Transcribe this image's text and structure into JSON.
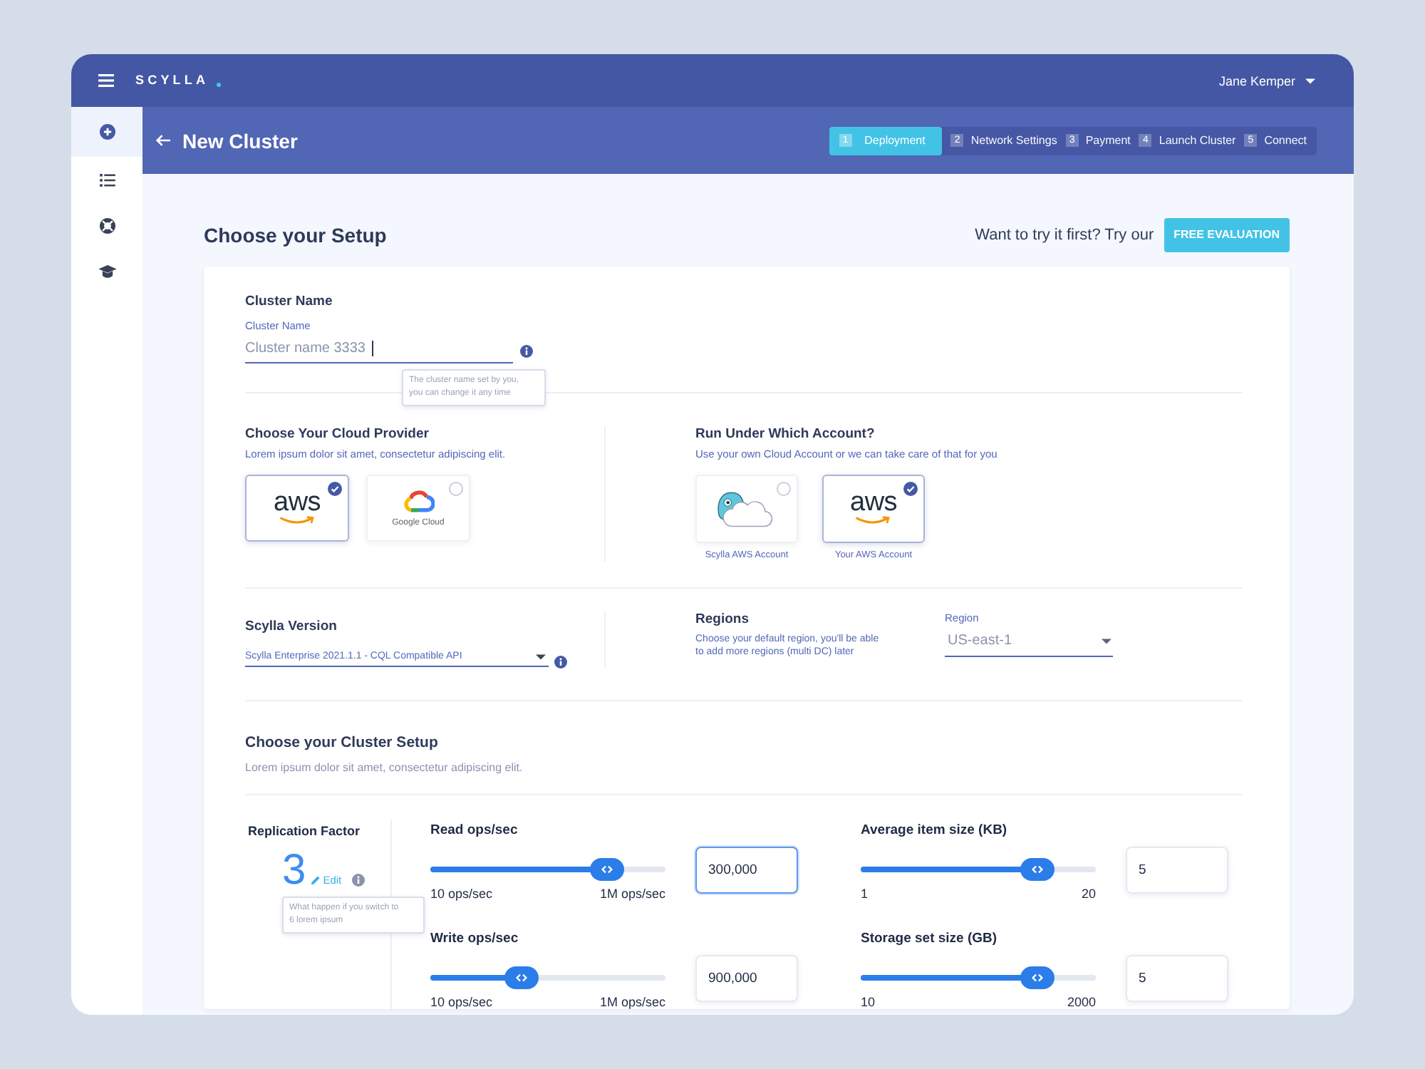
{
  "top_bar": {
    "brand": "SCYLLA",
    "user": "Jane Kemper"
  },
  "sidebar": {
    "items": [
      {
        "kind": "create",
        "selected": true
      },
      {
        "kind": "list",
        "selected": false
      },
      {
        "kind": "support",
        "selected": false
      },
      {
        "kind": "learn",
        "selected": false
      }
    ]
  },
  "header": {
    "title": "New Cluster",
    "steps": [
      {
        "number": "1",
        "label": "Deployment",
        "selected": true
      },
      {
        "number": "2",
        "label": "Network Settings",
        "selected": false
      },
      {
        "number": "3",
        "label": "Payment",
        "selected": false
      },
      {
        "number": "4",
        "label": "Launch Cluster",
        "selected": false
      },
      {
        "number": "5",
        "label": "Connect",
        "selected": false
      }
    ]
  },
  "page": {
    "title": "Choose your Setup",
    "promo_text": "Want to try it first? Try our",
    "promo_button": "FREE EVALUATION"
  },
  "cluster_name": {
    "heading": "Cluster Name",
    "label": "Cluster Name",
    "value": "Cluster name 3333",
    "tooltip": "The cluster name set by you, you can change it any time"
  },
  "cloud_provider": {
    "heading": "Choose Your Cloud Provider",
    "description": "Lorem ipsum dolor sit amet, consectetur adipiscing elit.",
    "options": [
      {
        "kind": "aws",
        "logo_text": "aws",
        "selected": true
      },
      {
        "kind": "google_cloud",
        "logo_text": "Google Cloud",
        "selected": false
      }
    ]
  },
  "account": {
    "heading": "Run Under Which Account?",
    "description": "Use your own Cloud Account or we can take care of that for you",
    "options": [
      {
        "kind": "scylla",
        "caption": "Scylla AWS Account",
        "selected": false
      },
      {
        "kind": "aws",
        "logo_text": "aws",
        "caption": "Your AWS Account",
        "selected": true
      }
    ]
  },
  "version": {
    "heading": "Scylla Version",
    "value": "Scylla Enterprise 2021.1.1 - CQL Compatible API"
  },
  "regions": {
    "heading": "Regions",
    "description": "Choose your default region, you'll be able to add more regions (multi DC) later",
    "label": "Region",
    "value": "US-east-1"
  },
  "cluster_setup": {
    "heading": "Choose your Cluster Setup",
    "description": "Lorem ipsum dolor sit amet, consectetur adipiscing elit.",
    "replication": {
      "label": "Replication Factor",
      "value": "3",
      "edit": "Edit",
      "tooltip": "What happen if you switch to 6 lorem ipsum"
    },
    "sliders": [
      {
        "label": "Read ops/sec",
        "level": 0.75,
        "min_label": "10 ops/sec",
        "max_label": "1M ops/sec",
        "value": "300,000",
        "focused": true
      },
      {
        "label": "Average item size (KB)",
        "level": 0.75,
        "min_label": "1",
        "max_label": "20",
        "value": "5",
        "focused": false
      },
      {
        "label": "Write ops/sec",
        "level": 0.39,
        "min_label": "10 ops/sec",
        "max_label": "1M ops/sec",
        "value": "900,000",
        "focused": false
      },
      {
        "label": "Storage set size (GB)",
        "level": 0.75,
        "min_label": "10",
        "max_label": "2000",
        "value": "5",
        "focused": false
      }
    ]
  }
}
